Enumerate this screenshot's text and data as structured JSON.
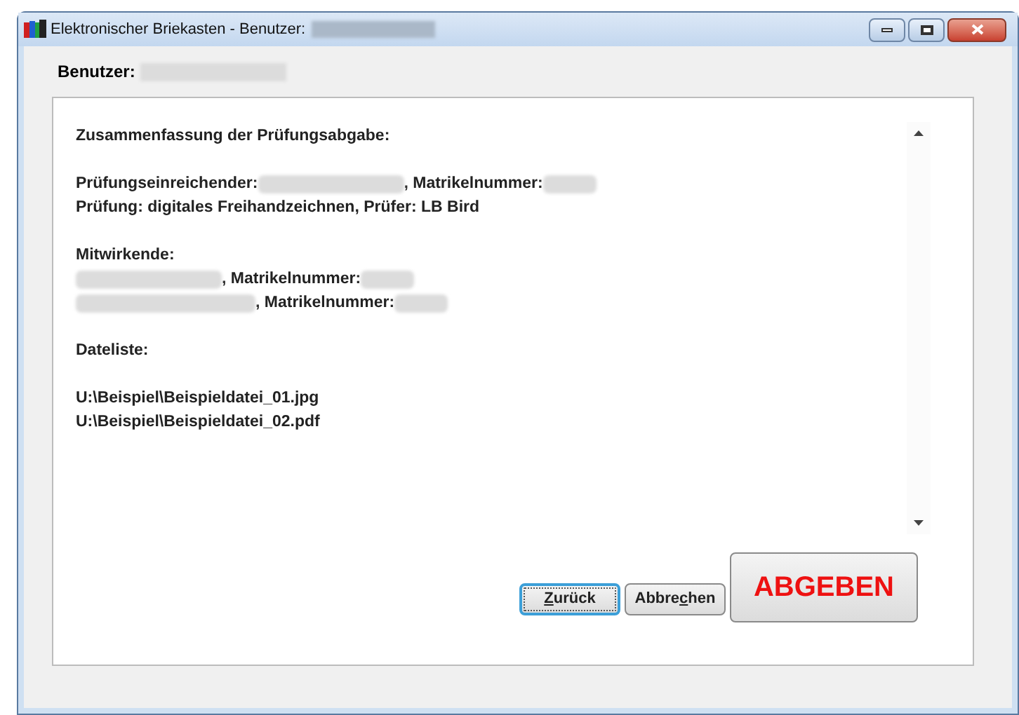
{
  "window": {
    "title": "Elektronischer Briekasten - Benutzer:"
  },
  "user_label": "Benutzer:",
  "summary": {
    "lines": [
      {
        "kind": "heading",
        "segments": [
          {
            "kind": "text",
            "text": "Zusammenfassung der Prüfungsabgabe:"
          }
        ]
      },
      {
        "kind": "gap"
      },
      {
        "kind": "line",
        "segments": [
          {
            "kind": "text",
            "text": "Prüfungseinreichender:"
          },
          {
            "kind": "blur_long"
          },
          {
            "kind": "text",
            "text": ", Matrikelnummer:"
          },
          {
            "kind": "blur_short"
          }
        ]
      },
      {
        "kind": "line",
        "segments": [
          {
            "kind": "text",
            "text": "Prüfung: digitales Freihandzeichnen, Prüfer: LB Bird"
          }
        ]
      },
      {
        "kind": "gap"
      },
      {
        "kind": "line",
        "segments": [
          {
            "kind": "text",
            "text": "Mitwirkende:"
          }
        ]
      },
      {
        "kind": "line",
        "segments": [
          {
            "kind": "blur_long"
          },
          {
            "kind": "text",
            "text": ", Matrikelnummer:"
          },
          {
            "kind": "blur_short"
          }
        ]
      },
      {
        "kind": "line",
        "segments": [
          {
            "kind": "blur_longer"
          },
          {
            "kind": "text",
            "text": ", Matrikelnummer:"
          },
          {
            "kind": "blur_short"
          }
        ]
      },
      {
        "kind": "gap"
      },
      {
        "kind": "line",
        "segments": [
          {
            "kind": "text",
            "text": "Dateliste:"
          }
        ]
      },
      {
        "kind": "gap"
      },
      {
        "kind": "line",
        "segments": [
          {
            "kind": "text",
            "text": "U:\\Beispiel\\Beispieldatei_01.jpg"
          }
        ]
      },
      {
        "kind": "line",
        "segments": [
          {
            "kind": "text",
            "text": "U:\\Beispiel\\Beispieldatei_02.pdf"
          }
        ]
      }
    ]
  },
  "buttons": [
    {
      "kind": "small",
      "access_key": "Z",
      "after": "urück",
      "focused": true
    },
    {
      "kind": "small",
      "before": "Abbre",
      "access_key": "c",
      "after": "hen",
      "focused": false
    },
    {
      "kind": "big",
      "label": "ABGEBEN",
      "focused": false
    }
  ]
}
